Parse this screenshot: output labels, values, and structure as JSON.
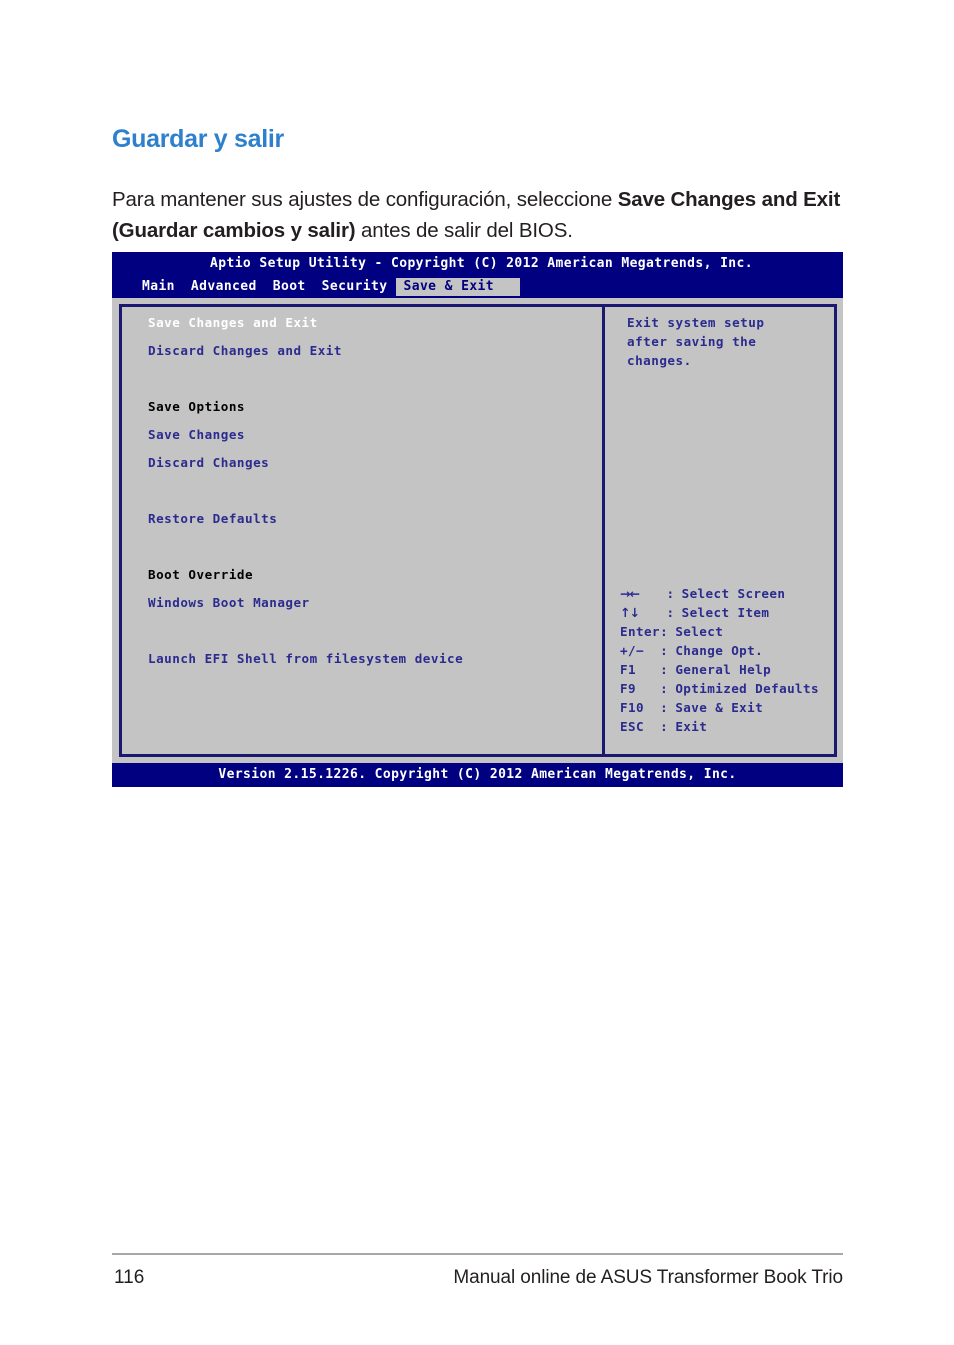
{
  "page": {
    "heading": "Guardar y salir",
    "paragraph": {
      "part1": "Para mantener sus ajustes de configuración, seleccione ",
      "bold1": "Save Changes and Exit (Guardar cambios y salir)",
      "part2": " antes de salir del BIOS."
    }
  },
  "bios": {
    "title": "Aptio Setup Utility - Copyright (C) 2012 American Megatrends, Inc.",
    "tabs": [
      {
        "label": "Main",
        "selected": false
      },
      {
        "label": "Advanced",
        "selected": false
      },
      {
        "label": "Boot",
        "selected": false
      },
      {
        "label": "Security",
        "selected": false
      },
      {
        "label": "Save & Exit",
        "selected": true
      }
    ],
    "menu": [
      {
        "label": "Save Changes and Exit",
        "style": "selected"
      },
      {
        "label": "Discard Changes and Exit",
        "style": "item"
      },
      {
        "label": "",
        "style": "spacer"
      },
      {
        "label": "Save Options",
        "style": "section-title"
      },
      {
        "label": "Save Changes",
        "style": "item"
      },
      {
        "label": "Discard Changes",
        "style": "item"
      },
      {
        "label": "",
        "style": "spacer"
      },
      {
        "label": "Restore Defaults",
        "style": "item"
      },
      {
        "label": "",
        "style": "spacer"
      },
      {
        "label": "Boot Override",
        "style": "section-title"
      },
      {
        "label": "Windows Boot Manager",
        "style": "item"
      },
      {
        "label": "",
        "style": "spacer"
      },
      {
        "label": "Launch EFI Shell from filesystem device",
        "style": "item"
      }
    ],
    "help": [
      "Exit system setup",
      "after saving the",
      "changes."
    ],
    "keys": [
      {
        "key": "→←",
        "sep": ": ",
        "desc": "Select Screen",
        "arrows": true
      },
      {
        "key": "↑↓",
        "sep": ": ",
        "desc": "Select Item",
        "arrows": true
      },
      {
        "key": "Enter",
        "sep": ": ",
        "desc": "Select",
        "arrows": false
      },
      {
        "key": "+/−",
        "sep": ": ",
        "desc": "Change Opt.",
        "arrows": false
      },
      {
        "key": "F1",
        "sep": ": ",
        "desc": "General Help",
        "arrows": false
      },
      {
        "key": "F9",
        "sep": ": ",
        "desc": "Optimized Defaults",
        "arrows": false
      },
      {
        "key": "F10",
        "sep": ": ",
        "desc": "Save & Exit",
        "arrows": false
      },
      {
        "key": "ESC",
        "sep": ": ",
        "desc": "Exit",
        "arrows": false
      }
    ],
    "footer": "Version 2.15.1226. Copyright (C) 2012 American Megatrends, Inc.",
    "colors": {
      "header_bg": "#000080",
      "panel_bg": "#c4c4c4",
      "border": "#191970",
      "item_text": "#2b2b8f",
      "selected_text": "#ffffff",
      "section_text": "#000000"
    }
  },
  "footer": {
    "page_number": "116",
    "doc_title": "Manual online de ASUS Transformer Book Trio"
  }
}
